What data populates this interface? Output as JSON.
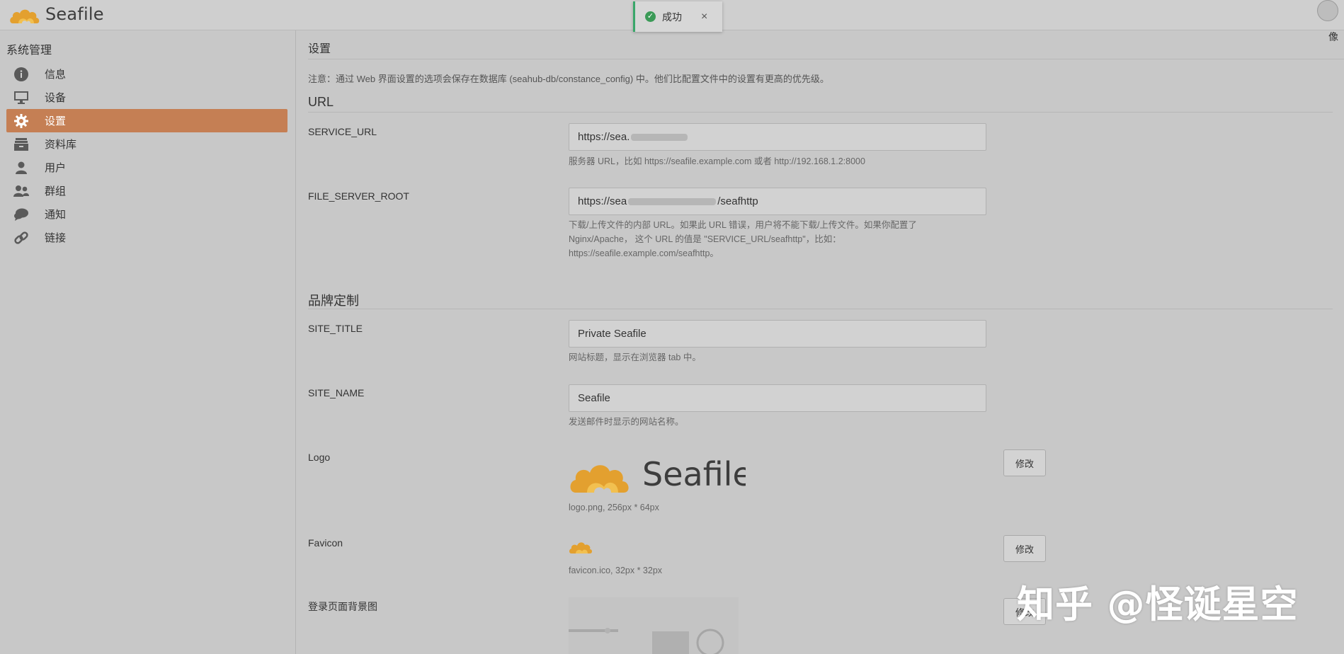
{
  "header": {
    "logo_text": "Seafile",
    "avatar_alt": "像"
  },
  "toast": {
    "message": "成功",
    "close_label": "×"
  },
  "sidebar": {
    "title": "系统管理",
    "items": [
      {
        "label": "信息",
        "icon": "info-icon"
      },
      {
        "label": "设备",
        "icon": "monitor-icon"
      },
      {
        "label": "设置",
        "icon": "gear-icon",
        "active": true
      },
      {
        "label": "资料库",
        "icon": "library-icon"
      },
      {
        "label": "用户",
        "icon": "user-icon"
      },
      {
        "label": "群组",
        "icon": "group-icon"
      },
      {
        "label": "通知",
        "icon": "notification-icon"
      },
      {
        "label": "链接",
        "icon": "link-icon"
      }
    ]
  },
  "main": {
    "title": "设置",
    "notice": "注意：通过 Web 界面设置的选项会保存在数据库 (seahub-db/constance_config) 中。他们比配置文件中的设置有更高的优先级。",
    "sections": {
      "url": "URL",
      "branding": "品牌定制"
    },
    "service_url": {
      "label": "SERVICE_URL",
      "value_prefix": "https://sea.",
      "help": "服务器 URL，比如 https://seafile.example.com 或者 http://192.168.1.2:8000"
    },
    "file_server_root": {
      "label": "FILE_SERVER_ROOT",
      "value_prefix": "https://sea",
      "value_suffix": "/seafhttp",
      "help": "下载/上传文件的内部 URL。如果此 URL 错误，用户将不能下载/上传文件。如果你配置了 Nginx/Apache， 这个 URL 的值是 \"SERVICE_URL/seafhttp\"，比如：https://seafile.example.com/seafhttp。"
    },
    "site_title": {
      "label": "SITE_TITLE",
      "value": "Private Seafile",
      "help": "网站标题，显示在浏览器 tab 中。"
    },
    "site_name": {
      "label": "SITE_NAME",
      "value": "Seafile",
      "help": "发送邮件时显示的网站名称。"
    },
    "logo": {
      "label": "Logo",
      "image_text": "Seafile",
      "caption": "logo.png, 256px * 64px",
      "button": "修改"
    },
    "favicon": {
      "label": "Favicon",
      "caption": "favicon.ico, 32px * 32px",
      "button": "修改"
    },
    "login_bg": {
      "label": "登录页面背景图",
      "button": "修改"
    }
  },
  "watermark": "知乎 @怪诞星空",
  "colors": {
    "accent": "#c57f54",
    "success": "#3b9a57",
    "brand_orange": "#e8a736"
  }
}
